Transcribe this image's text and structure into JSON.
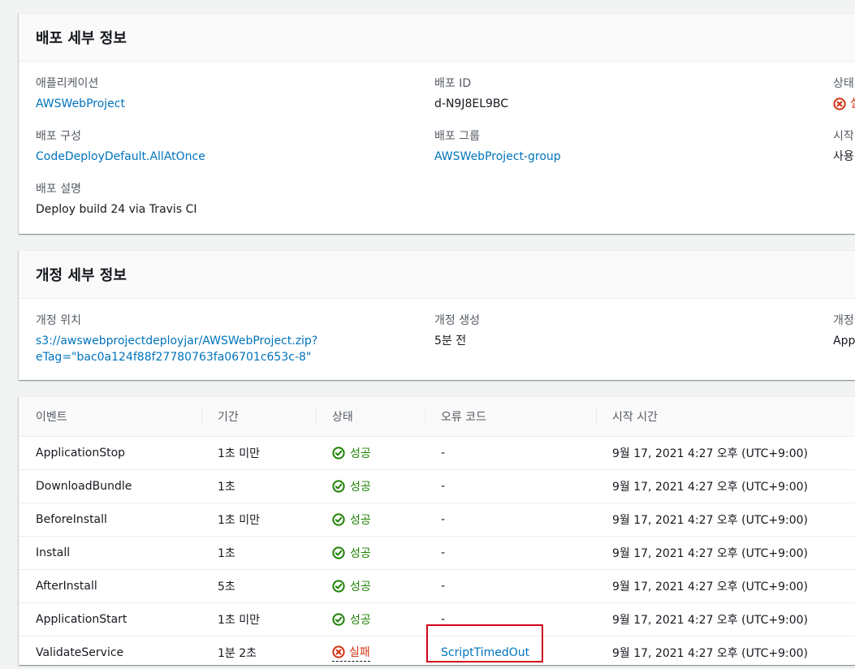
{
  "deployment": {
    "title": "배포 세부 정보",
    "application_label": "애플리케이션",
    "application_value": "AWSWebProject",
    "deployment_id_label": "배포 ID",
    "deployment_id_value": "d-N9J8EL9BC",
    "status_label": "상태",
    "status_value": "실패",
    "config_label": "배포 구성",
    "config_value": "CodeDeployDefault.AllAtOnce",
    "group_label": "배포 그룹",
    "group_value": "AWSWebProject-group",
    "initiated_label": "시작",
    "initiated_value": "사용",
    "description_label": "배포 설명",
    "description_value": "Deploy build 24 via Travis CI"
  },
  "revision": {
    "title": "개정 세부 정보",
    "location_label": "개정 위치",
    "location_line1": "s3://awswebprojectdeployjar/AWSWebProject.zip?",
    "location_line2": "eTag=\"bac0a124f88f27780763fa06701c653c-8\"",
    "created_label": "개정 생성",
    "created_value": "5분 전",
    "desc_label": "개정",
    "desc_value": "Appl"
  },
  "events": {
    "headers": [
      "이벤트",
      "기간",
      "상태",
      "오류 코드",
      "시작 시간"
    ],
    "rows": [
      {
        "event": "ApplicationStop",
        "duration": "1초 미만",
        "status": "성공",
        "error": "-",
        "start": "9월 17, 2021 4:27 오후 (UTC+9:00)"
      },
      {
        "event": "DownloadBundle",
        "duration": "1초",
        "status": "성공",
        "error": "-",
        "start": "9월 17, 2021 4:27 오후 (UTC+9:00)"
      },
      {
        "event": "BeforeInstall",
        "duration": "1초 미만",
        "status": "성공",
        "error": "-",
        "start": "9월 17, 2021 4:27 오후 (UTC+9:00)"
      },
      {
        "event": "Install",
        "duration": "1초",
        "status": "성공",
        "error": "-",
        "start": "9월 17, 2021 4:27 오후 (UTC+9:00)"
      },
      {
        "event": "AfterInstall",
        "duration": "5초",
        "status": "성공",
        "error": "-",
        "start": "9월 17, 2021 4:27 오후 (UTC+9:00)"
      },
      {
        "event": "ApplicationStart",
        "duration": "1초 미만",
        "status": "성공",
        "error": "-",
        "start": "9월 17, 2021 4:27 오후 (UTC+9:00)"
      },
      {
        "event": "ValidateService",
        "duration": "1분 2초",
        "status": "실패",
        "error": "ScriptTimedOut",
        "start": "9월 17, 2021 4:27 오후 (UTC+9:00)"
      }
    ]
  },
  "colors": {
    "link": "#0073bb",
    "success": "#1d8102",
    "error": "#d13212",
    "highlight": "#d0021b"
  },
  "icons": {
    "success": "check-circle-icon",
    "failure": "x-circle-icon"
  }
}
